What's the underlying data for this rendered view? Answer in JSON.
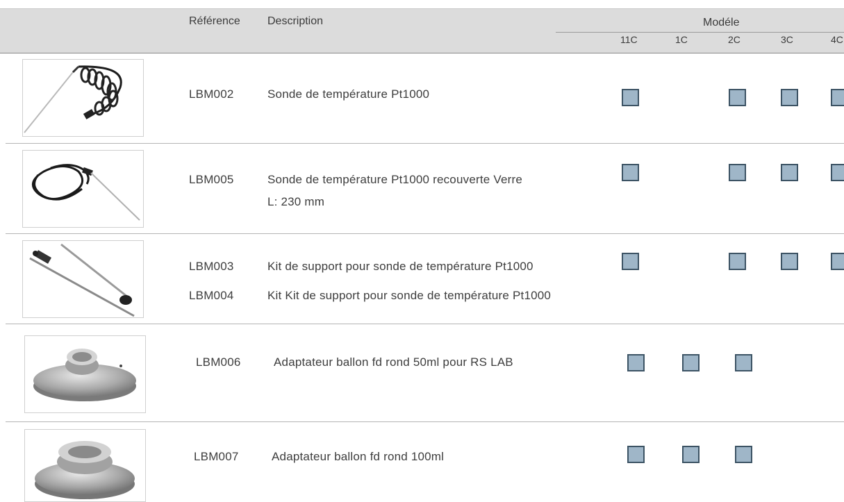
{
  "header": {
    "reference": "Référence",
    "description": "Description",
    "model": "Modéle",
    "models": [
      "11C",
      "1C",
      "2C",
      "3C",
      "4C"
    ]
  },
  "colors": {
    "header_bg": "#dcdcdc",
    "check_fill": "#9fb6c8",
    "check_border": "#3c5364",
    "separator": "#b4b4b4"
  },
  "rows": [
    {
      "image": "temperature-probe-coiled-cable",
      "lines": [
        {
          "ref": "LBM002",
          "desc": "Sonde de température Pt1000"
        }
      ],
      "available": {
        "11C": true,
        "1C": false,
        "2C": true,
        "3C": true,
        "4C": true
      }
    },
    {
      "image": "temperature-probe-glass-coated",
      "lines": [
        {
          "ref": "LBM005",
          "desc": "Sonde de température Pt1000 recouverte Verre"
        }
      ],
      "extra": "L: 230 mm",
      "available": {
        "11C": true,
        "1C": false,
        "2C": true,
        "3C": true,
        "4C": true
      }
    },
    {
      "image": "probe-support-kit",
      "lines": [
        {
          "ref": "LBM003",
          "desc": "Kit de support pour sonde de température Pt1000"
        },
        {
          "ref": "LBM004",
          "desc": "Kit Kit de support pour sonde de température Pt1000"
        }
      ],
      "available": {
        "11C": true,
        "1C": false,
        "2C": true,
        "3C": true,
        "4C": true
      }
    },
    {
      "image": "round-flask-adapter-50ml",
      "lines": [
        {
          "ref": "LBM006",
          "desc": "Adaptateur ballon fd rond 50ml pour RS LAB"
        }
      ],
      "available": {
        "11C": true,
        "1C": true,
        "2C": true,
        "3C": false,
        "4C": false
      }
    },
    {
      "image": "round-flask-adapter-100ml",
      "lines": [
        {
          "ref": "LBM007",
          "desc": "Adaptateur ballon fd rond 100ml"
        }
      ],
      "available": {
        "11C": true,
        "1C": true,
        "2C": true,
        "3C": false,
        "4C": false
      }
    }
  ]
}
